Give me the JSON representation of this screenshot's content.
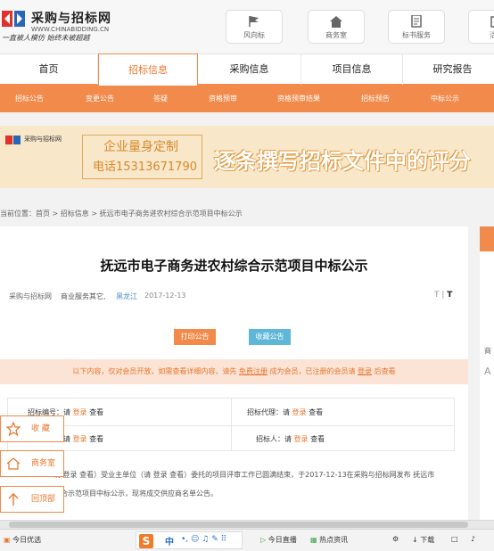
{
  "header": {
    "logo_cn": "采购与招标网",
    "logo_en": "WWW.CHINABIDDING.CN",
    "slogan": "一直被人模仿  始终未被超越",
    "quick_buttons": [
      {
        "label": "风向标",
        "icon": "flag-icon"
      },
      {
        "label": "商务室",
        "icon": "home-icon"
      },
      {
        "label": "标书服务",
        "icon": "document-icon"
      },
      {
        "label": "活动",
        "icon": "calendar-icon"
      }
    ]
  },
  "nav": {
    "items": [
      "首页",
      "招标信息",
      "采购信息",
      "项目信息",
      "研究报告"
    ],
    "active": "招标信息"
  },
  "subnav": {
    "items": [
      "招标公告",
      "变更公告",
      "答疑",
      "资格预审",
      "资格预审结果",
      "招标预告",
      "中标公示"
    ]
  },
  "banner": {
    "logo_text": "采购与招标网",
    "line1": "企业量身定制",
    "line2": "电话15313671790",
    "slogan": "逐条撰写招标文件中的评分"
  },
  "breadcrumb": {
    "text": "当前位置：首页 > 招标信息 > 抚远市电子商务进农村综合示范项目中标公示"
  },
  "article": {
    "title": "抚远市电子商务进农村综合示范项目中标公示",
    "source": "采购与招标网",
    "category": "商业服务其它,",
    "region": "黑龙江",
    "date": "2017-12-13",
    "font_small": "T",
    "font_large": "T",
    "print_label": "打印公告",
    "favorite_label": "收藏公告",
    "notice_prefix": "以下内容，仅对会员开放，如需查看详细内容，请先",
    "notice_register": "免费注册",
    "notice_mid": "成为会员，已注册的会员请",
    "notice_login": "登录",
    "notice_suffix": "后查看",
    "fields": {
      "bid_no_label": "招标编号：请",
      "agent_label": "招标代理：请",
      "row2_left_label": "请",
      "tenderer_label": "招标人：请",
      "login": "登录",
      "view": "查看"
    },
    "para1": "请 登录 查看）受业主单位（请 登录 查看）委托的项目评审工作已圆满结束，于2017-12-13在采购与招标网发布 抚远市",
    "para2": "综合示范项目中标公示，现将成交供应商名单公告。"
  },
  "float_buttons": [
    {
      "label": "收 藏",
      "icon": "star-icon"
    },
    {
      "label": "商务室",
      "icon": "home-icon"
    },
    {
      "label": "回顶部",
      "icon": "arrow-up-icon"
    }
  ],
  "right_side": {
    "t1": "商",
    "t2": "A"
  },
  "taskbar": {
    "left": "今日优选",
    "items": [
      "今日直播",
      "热点资讯",
      "下载"
    ],
    "ime_logo": "S",
    "ime_mode": "中"
  }
}
